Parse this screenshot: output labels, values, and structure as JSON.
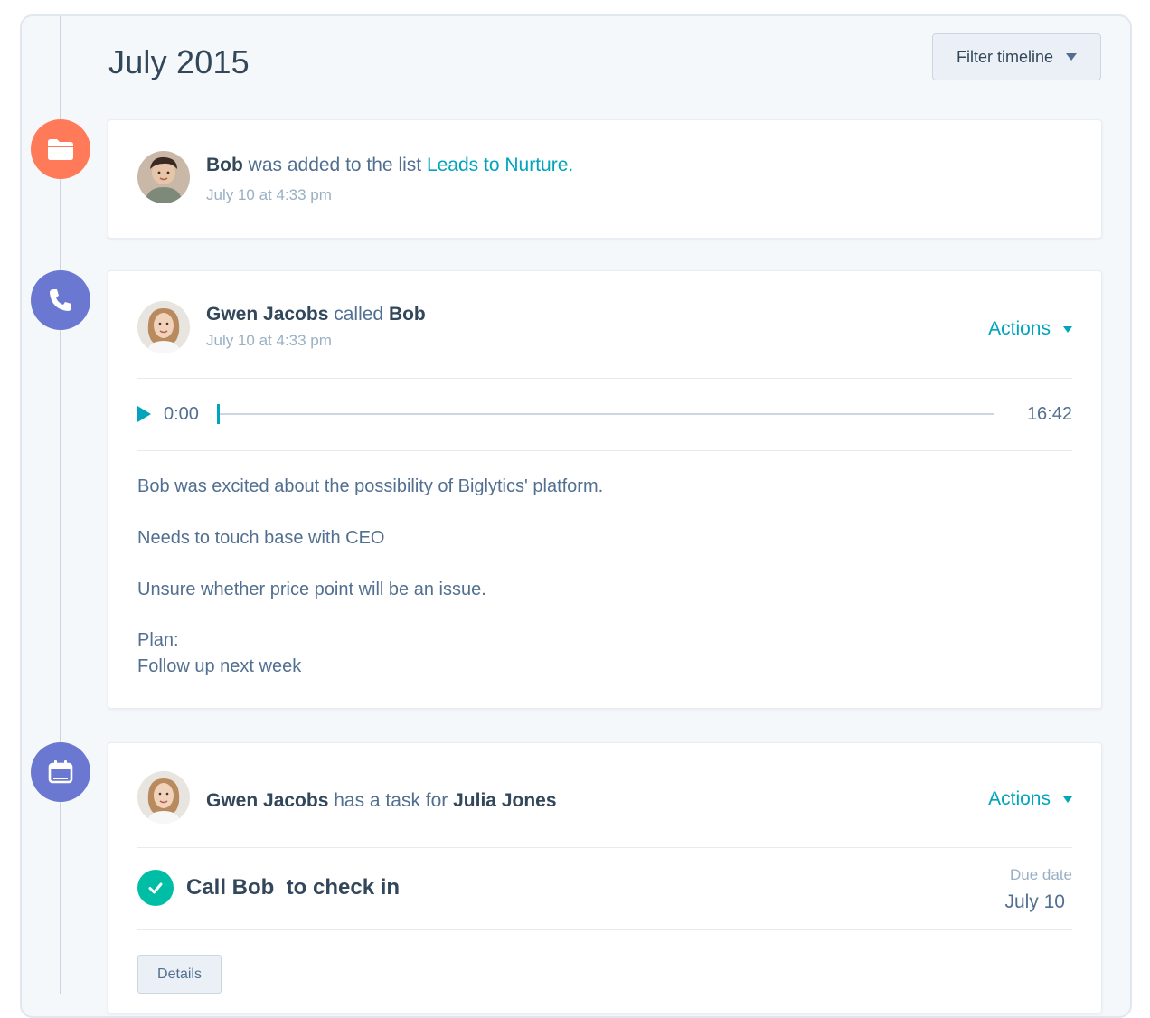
{
  "timeline": {
    "month": "July 2015",
    "filter_label": "Filter timeline"
  },
  "events": [
    {
      "icon": "folder-icon",
      "color": "#ff7a59",
      "subject": "Bob",
      "verb": " was added to the list ",
      "link": "Leads to Nurture.",
      "timestamp": "July 10 at 4:33 pm"
    },
    {
      "icon": "phone-icon",
      "color": "#6a78d1",
      "actor": "Gwen Jacobs",
      "verb": " called ",
      "target": "Bob",
      "timestamp": "July 10 at 4:33 pm",
      "actions_label": "Actions",
      "recording": {
        "current_time": "0:00",
        "total_time": "16:42",
        "progress": 0
      },
      "notes": [
        "Bob was excited about the possibility of Biglytics' platform.",
        "Needs to touch base with CEO",
        "Unsure whether price point will be an issue.",
        "Plan:",
        "Follow up next week"
      ]
    },
    {
      "icon": "calendar-icon",
      "color": "#6a78d1",
      "actor": "Gwen Jacobs",
      "verb": " has a task for ",
      "target": "Julia Jones",
      "actions_label": "Actions",
      "task_title": "Call Bob  to check in",
      "due_label": "Due date",
      "due_value": "July 10",
      "details_label": "Details"
    }
  ]
}
